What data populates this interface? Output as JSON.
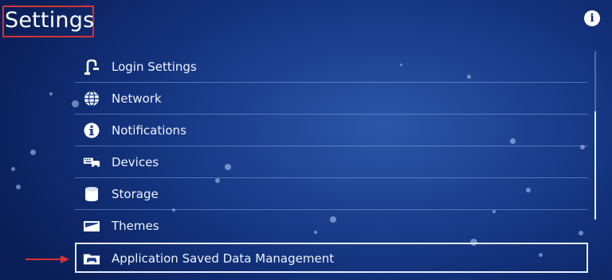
{
  "header": {
    "title": "Settings",
    "info_icon": "info-icon",
    "highlight_color": "#d83232"
  },
  "menu": {
    "items": [
      {
        "label": "Login Settings",
        "icon": "login-icon"
      },
      {
        "label": "Network",
        "icon": "globe-icon"
      },
      {
        "label": "Notifications",
        "icon": "info-circle-icon"
      },
      {
        "label": "Devices",
        "icon": "devices-icon"
      },
      {
        "label": "Storage",
        "icon": "storage-icon"
      },
      {
        "label": "Themes",
        "icon": "themes-icon"
      },
      {
        "label": "Application Saved Data Management",
        "icon": "folder-controller-icon",
        "selected": true
      }
    ]
  },
  "annotation": {
    "arrow_color": "#d83232"
  }
}
